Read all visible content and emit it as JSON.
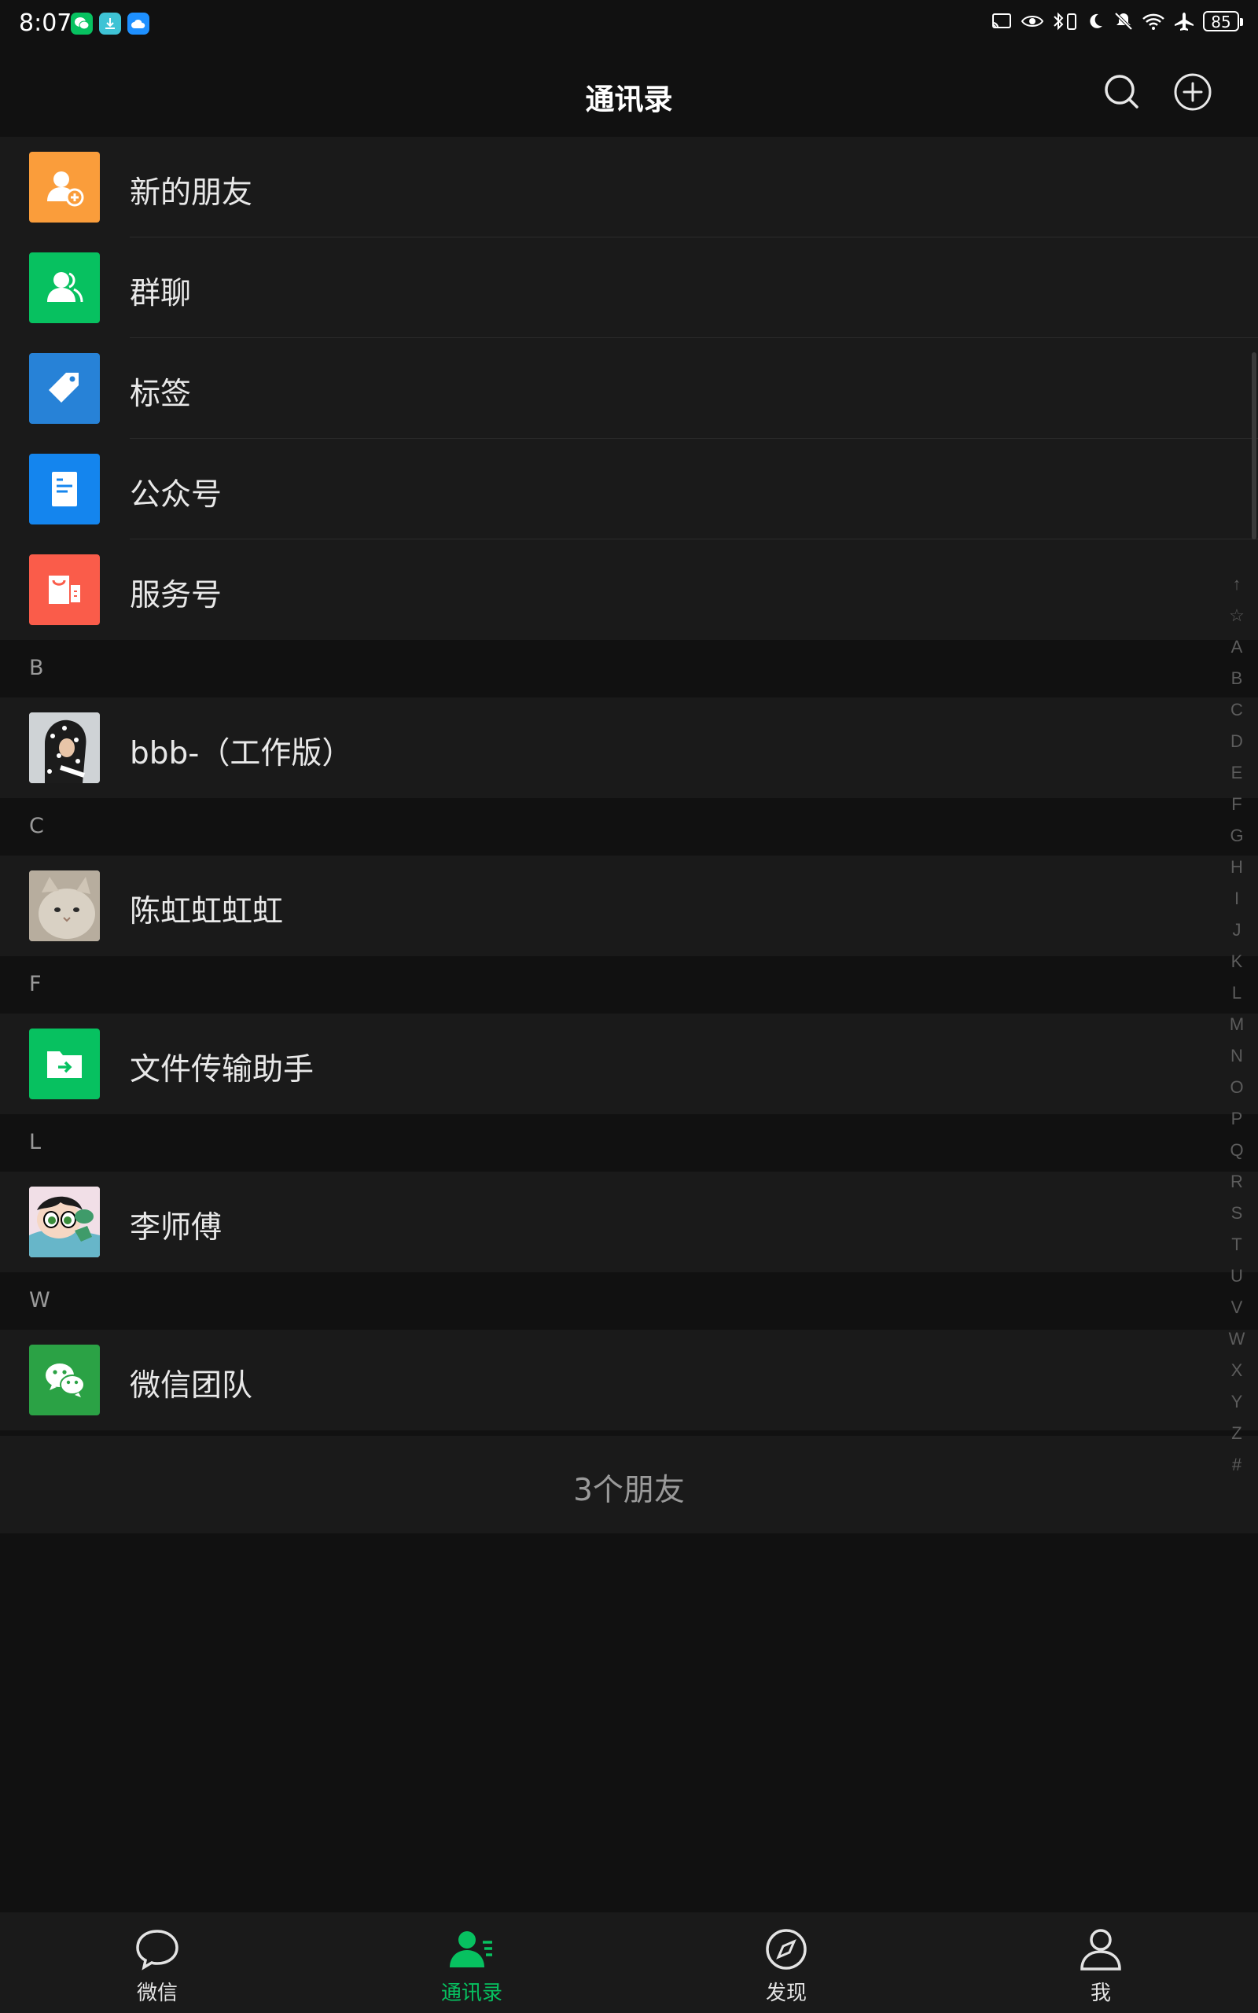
{
  "status_bar": {
    "time": "8:07",
    "battery": "85"
  },
  "header": {
    "title": "通讯录"
  },
  "feature_items": [
    {
      "label": "新的朋友",
      "icon": "add-friend-icon",
      "color": "#fa9d3b"
    },
    {
      "label": "群聊",
      "icon": "group-chat-icon",
      "color": "#07c160"
    },
    {
      "label": "标签",
      "icon": "tag-icon",
      "color": "#2782d7"
    },
    {
      "label": "公众号",
      "icon": "official-account-icon",
      "color": "#1485ee"
    },
    {
      "label": "服务号",
      "icon": "service-account-icon",
      "color": "#fa5c4a"
    }
  ],
  "contact_groups": [
    {
      "letter": "B",
      "contacts": [
        {
          "name": "bbb-（工作版）"
        }
      ]
    },
    {
      "letter": "C",
      "contacts": [
        {
          "name": "陈虹虹虹虹"
        }
      ]
    },
    {
      "letter": "F",
      "contacts": [
        {
          "name": "文件传输助手"
        }
      ]
    },
    {
      "letter": "L",
      "contacts": [
        {
          "name": "李师傅"
        }
      ]
    },
    {
      "letter": "W",
      "contacts": [
        {
          "name": "微信团队"
        }
      ]
    }
  ],
  "footer": {
    "friend_count": "3个朋友"
  },
  "index_letters": [
    "↑",
    "☆",
    "A",
    "B",
    "C",
    "D",
    "E",
    "F",
    "G",
    "H",
    "I",
    "J",
    "K",
    "L",
    "M",
    "N",
    "O",
    "P",
    "Q",
    "R",
    "S",
    "T",
    "U",
    "V",
    "W",
    "X",
    "Y",
    "Z",
    "#"
  ],
  "bottom_nav": [
    {
      "label": "微信",
      "icon": "chat-bubble-icon",
      "active": false
    },
    {
      "label": "通讯录",
      "icon": "contacts-icon",
      "active": true
    },
    {
      "label": "发现",
      "icon": "compass-icon",
      "active": false
    },
    {
      "label": "我",
      "icon": "person-icon",
      "active": false
    }
  ],
  "colors": {
    "accent": "#07c160",
    "background": "#111111",
    "row": "#1a1a1a"
  }
}
